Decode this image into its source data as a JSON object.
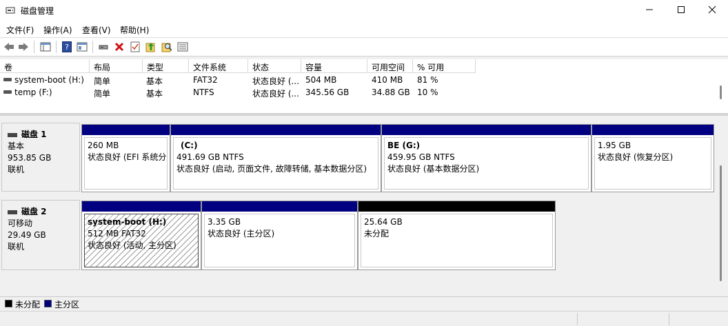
{
  "window": {
    "title": "磁盘管理"
  },
  "menu": [
    "文件(F)",
    "操作(A)",
    "查看(V)",
    "帮助(H)"
  ],
  "toolbar_icons": [
    "back-icon",
    "forward-icon",
    "console-tree-icon",
    "help-icon",
    "properties-icon",
    "connect-icon",
    "delete-icon",
    "check-icon",
    "up-arrow-icon",
    "search-icon",
    "list-icon"
  ],
  "volumes": {
    "columns": [
      "卷",
      "布局",
      "类型",
      "文件系统",
      "状态",
      "容量",
      "可用空间",
      "% 可用"
    ],
    "rows": [
      [
        "system-boot (H:)",
        "简单",
        "基本",
        "FAT32",
        "状态良好 (...",
        "504 MB",
        "410 MB",
        "81 %"
      ],
      [
        "temp (F:)",
        "简单",
        "基本",
        "NTFS",
        "状态良好 (...",
        "345.56 GB",
        "34.88 GB",
        "10 %"
      ]
    ]
  },
  "disks": [
    {
      "title": "磁盘 1",
      "kind": "基本",
      "size": "953.85 GB",
      "state": "联机",
      "partitions": [
        {
          "name": "",
          "line1": "260 MB",
          "line2": "状态良好 (EFI 系统分"
        },
        {
          "name": "(C:)",
          "line1": "491.69 GB NTFS",
          "line2": "状态良好 (启动, 页面文件, 故障转储, 基本数据分区)"
        },
        {
          "name": "BE  (G:)",
          "line1": "459.95 GB NTFS",
          "line2": "状态良好 (基本数据分区)"
        },
        {
          "name": "",
          "line1": "1.95 GB",
          "line2": "状态良好 (恢复分区)"
        }
      ]
    },
    {
      "title": "磁盘 2",
      "kind": "可移动",
      "size": "29.49 GB",
      "state": "联机",
      "partitions": [
        {
          "name": "system-boot  (H:)",
          "line1": "512 MB FAT32",
          "line2": "状态良好 (活动, 主分区)"
        },
        {
          "name": "",
          "line1": "3.35 GB",
          "line2": "状态良好 (主分区)"
        },
        {
          "name": "",
          "line1": "25.64 GB",
          "line2": "未分配"
        }
      ]
    }
  ],
  "legend": [
    {
      "label": "未分配",
      "color": "#000000"
    },
    {
      "label": "主分区",
      "color": "#000080"
    }
  ],
  "colors": {
    "primary_partition": "#000080",
    "unallocated": "#000000",
    "selected_hatch": "#9a9a9a"
  }
}
